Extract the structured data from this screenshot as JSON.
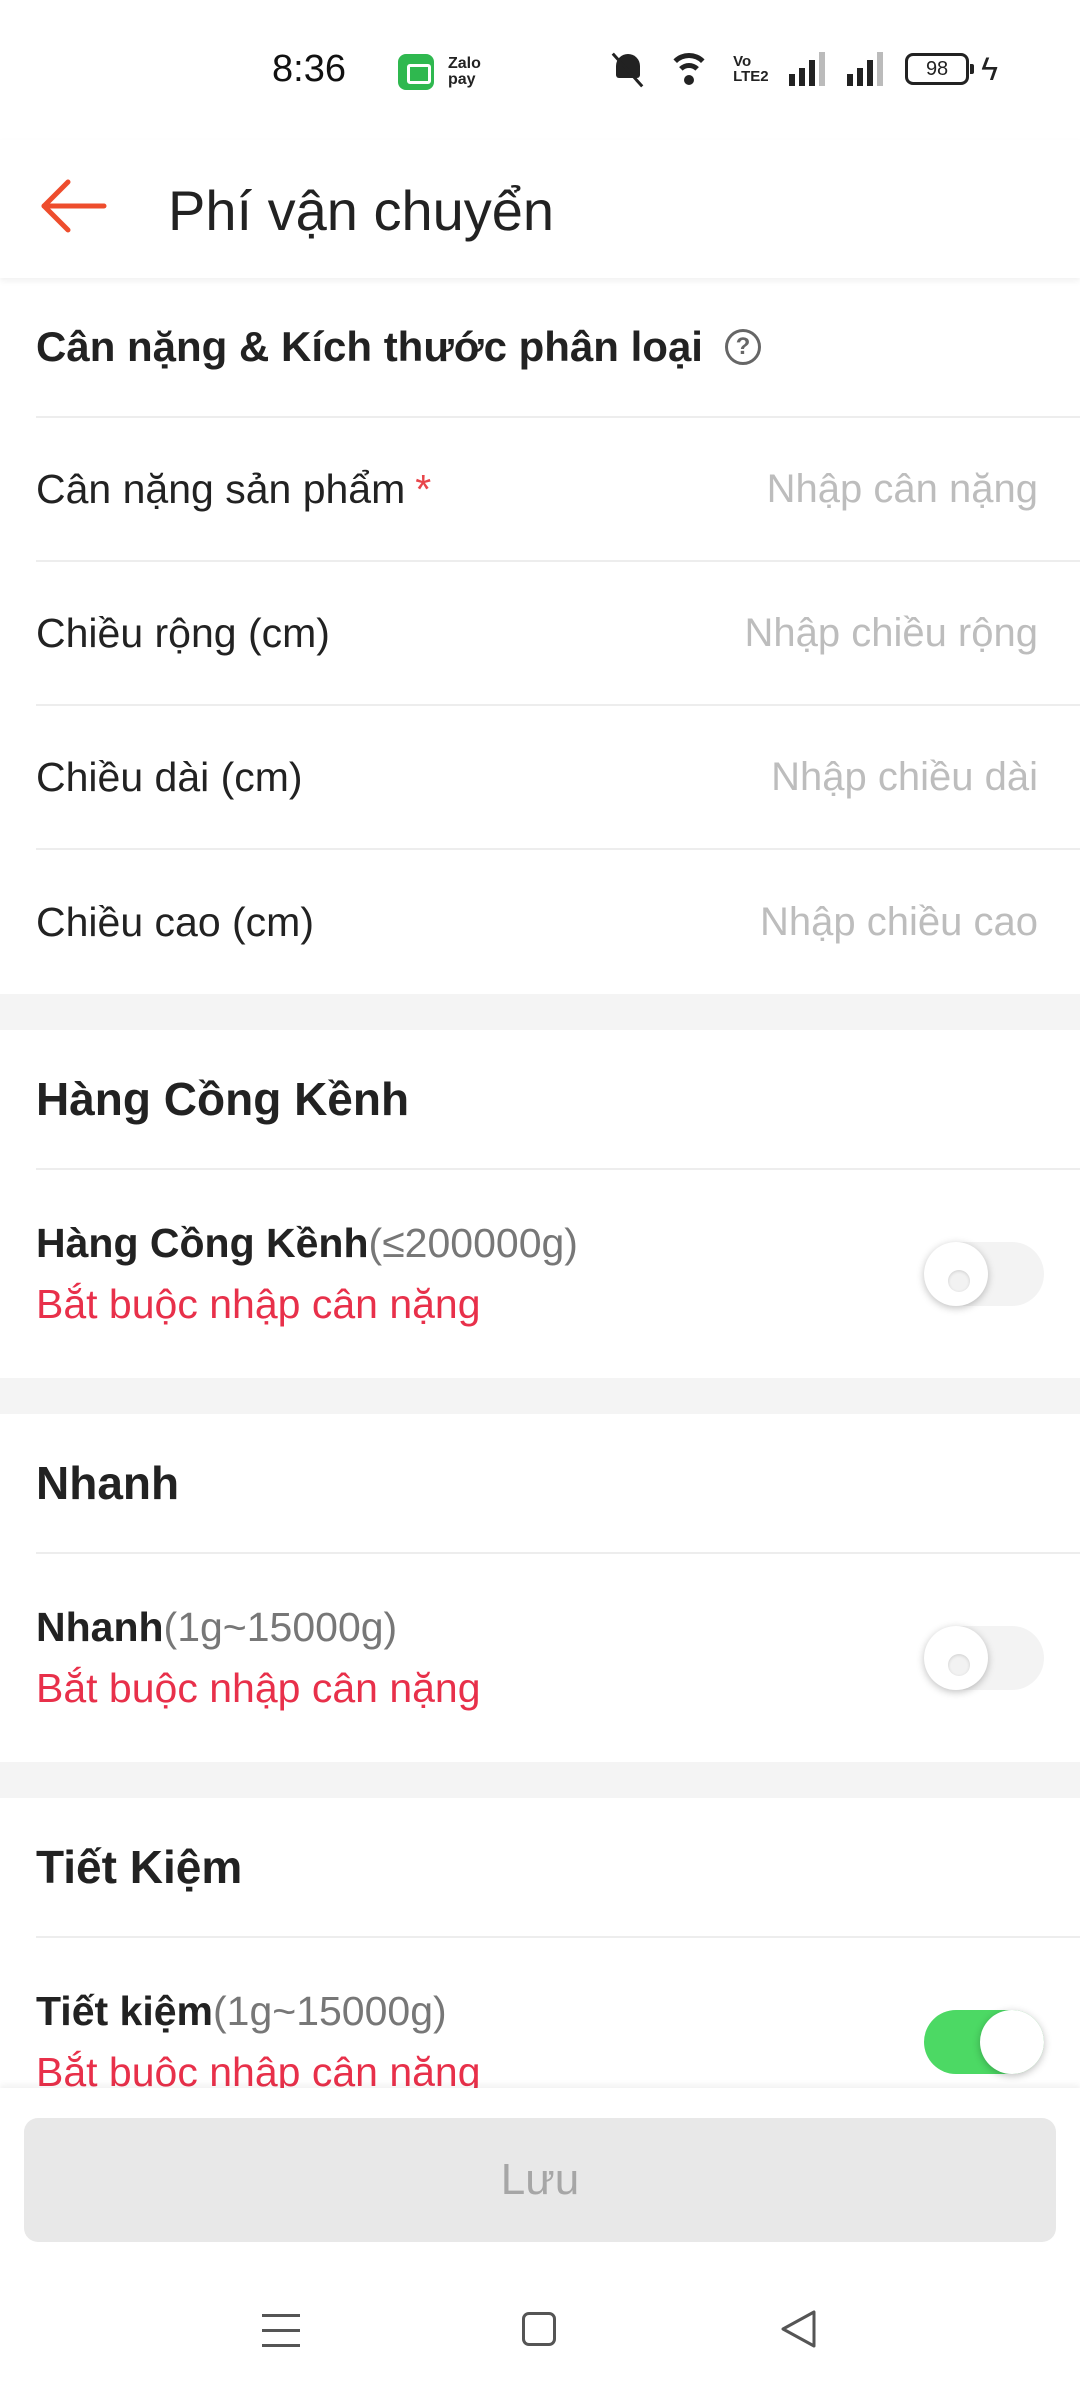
{
  "status_bar": {
    "time": "8:36",
    "app_label": "Zalo pay",
    "battery": "98"
  },
  "header": {
    "title": "Phí vận chuyển"
  },
  "dimensions": {
    "title": "Cân nặng & Kích thước phân loại",
    "help": "?",
    "fields": [
      {
        "label": "Cân nặng sản phẩm",
        "required": "*",
        "placeholder": "Nhập cân nặng"
      },
      {
        "label": "Chiều rộng (cm)",
        "placeholder": "Nhập chiều rộng"
      },
      {
        "label": "Chiều dài (cm)",
        "placeholder": "Nhập chiều dài"
      },
      {
        "label": "Chiều cao (cm)",
        "placeholder": "Nhập chiều cao"
      }
    ]
  },
  "shipping": [
    {
      "section_title": "Hàng Cồng Kềnh",
      "name": "Hàng Cồng Kềnh",
      "range": "(≤200000g)",
      "warning": "Bắt buộc nhập cân nặng",
      "enabled": false
    },
    {
      "section_title": "Nhanh",
      "name": "Nhanh",
      "range": "(1g~15000g)",
      "warning": "Bắt buộc nhập cân nặng",
      "enabled": false
    },
    {
      "section_title": "Tiết Kiệm",
      "name": "Tiết kiệm",
      "range": "(1g~15000g)",
      "warning": "Bắt buộc nhập cân nặng",
      "enabled": true
    }
  ],
  "footer": {
    "save_label": "Lưu"
  },
  "colors": {
    "accent": "#ee4d2d",
    "warning": "#e8304a",
    "toggle_on": "#4cd964"
  }
}
